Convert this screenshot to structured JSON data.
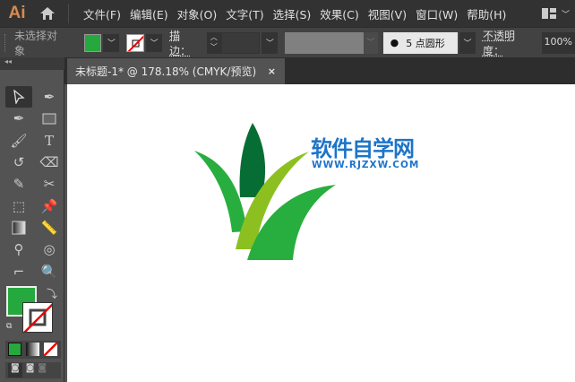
{
  "app": {
    "logo": "Ai"
  },
  "menu": [
    "文件(F)",
    "编辑(E)",
    "对象(O)",
    "文字(T)",
    "选择(S)",
    "效果(C)",
    "视图(V)",
    "窗口(W)",
    "帮助(H)"
  ],
  "control": {
    "selection_status": "未选择对象",
    "stroke_label": "描边：",
    "brush": "5 点圆形",
    "opacity_label": "不透明度：",
    "opacity_value": "100%",
    "fill_color": "#25a83d"
  },
  "document": {
    "tab_title": "未标题-1* @ 178.18% (CMYK/预览)",
    "close": "×"
  },
  "logo_art": {
    "title": "软件自学网",
    "url": "WWW.RJZXW.COM",
    "colors": {
      "leaf_light": "#27ae3f",
      "leaf_dark": "#066e35",
      "leaf_lime": "#8cc021",
      "text": "#1d74c9"
    }
  },
  "tools": [
    "selection",
    "direct-selection",
    "pen",
    "curvature",
    "rectangle",
    "paintbrush",
    "type",
    "rotate",
    "eraser",
    "pencil",
    "scissors",
    "free-transform",
    "puppet-warp",
    "gradient",
    "measure",
    "eyedropper",
    "shape-builder",
    "artboard",
    "zoom"
  ]
}
